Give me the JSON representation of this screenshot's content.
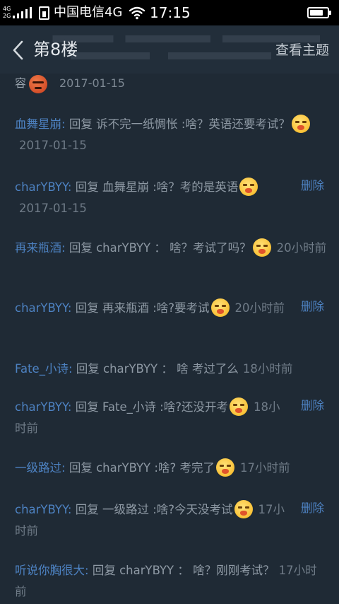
{
  "status_bar": {
    "signal_label_top": "4G",
    "signal_label_bottom": "2G",
    "carrier": "中国电信4G",
    "time": "17:15",
    "battery_level": 0.8
  },
  "header": {
    "back_icon": "chevron-left-icon",
    "title": "第8楼",
    "topic_link": "查看主题"
  },
  "top_snippet": {
    "text": "容",
    "time": "2017-01-15"
  },
  "comments": [
    {
      "author": "血舞星崩",
      "colon": ":",
      "reply": "回复",
      "target": "诉不完一纸惆怅",
      "content": ":啥？英语还要考试？",
      "emoji": true,
      "time": "2017-01-15",
      "delete": ""
    },
    {
      "author": "charYBYY",
      "colon": ":",
      "reply": "回复",
      "target": "血舞星崩",
      "content": ":啥？考的是英语",
      "emoji": true,
      "time": "2017-01-15",
      "delete": "删除"
    },
    {
      "author": "再来瓶酒",
      "colon": ":",
      "reply": "回复",
      "target": "charYBYY",
      "content": "： 啥？考试了吗？",
      "emoji": true,
      "time": "20小时前",
      "delete": ""
    },
    {
      "author": "charYBYY",
      "colon": ":",
      "reply": "回复",
      "target": "再来瓶酒",
      "content": ":啥?要考试",
      "emoji": true,
      "time": "20小时前",
      "delete": "删除"
    },
    {
      "author": "Fate_小诗",
      "colon": ":",
      "reply": "回复",
      "target": "charYBYY",
      "content": "： 啥 考过了么",
      "emoji": false,
      "time": "18小时前",
      "delete": ""
    },
    {
      "author": "charYBYY",
      "colon": ":",
      "reply": "回复",
      "target": "Fate_小诗",
      "content": ":啥?还没开考",
      "emoji": true,
      "time": "18小时前",
      "delete": "删除"
    },
    {
      "author": "一级路过",
      "colon": ":",
      "reply": "回复",
      "target": "charYBYY",
      "content": ":啥? 考完了",
      "emoji": true,
      "time": "17小时前",
      "delete": ""
    },
    {
      "author": "charYBYY",
      "colon": ":",
      "reply": "回复",
      "target": "一级路过",
      "content": ":啥?今天没考试",
      "emoji": true,
      "time": "17小时前",
      "delete": "删除"
    },
    {
      "author": "听说你胸很大",
      "colon": ":",
      "reply": "回复",
      "target": "charYBYY",
      "content": "： 啥？刚刚考试？",
      "emoji": false,
      "time": "17小时前",
      "delete": ""
    }
  ],
  "colors": {
    "background": "#1f2a35",
    "author": "#4d82c2",
    "text": "#8e99a4",
    "emoji_yellow": "#f7b319"
  }
}
